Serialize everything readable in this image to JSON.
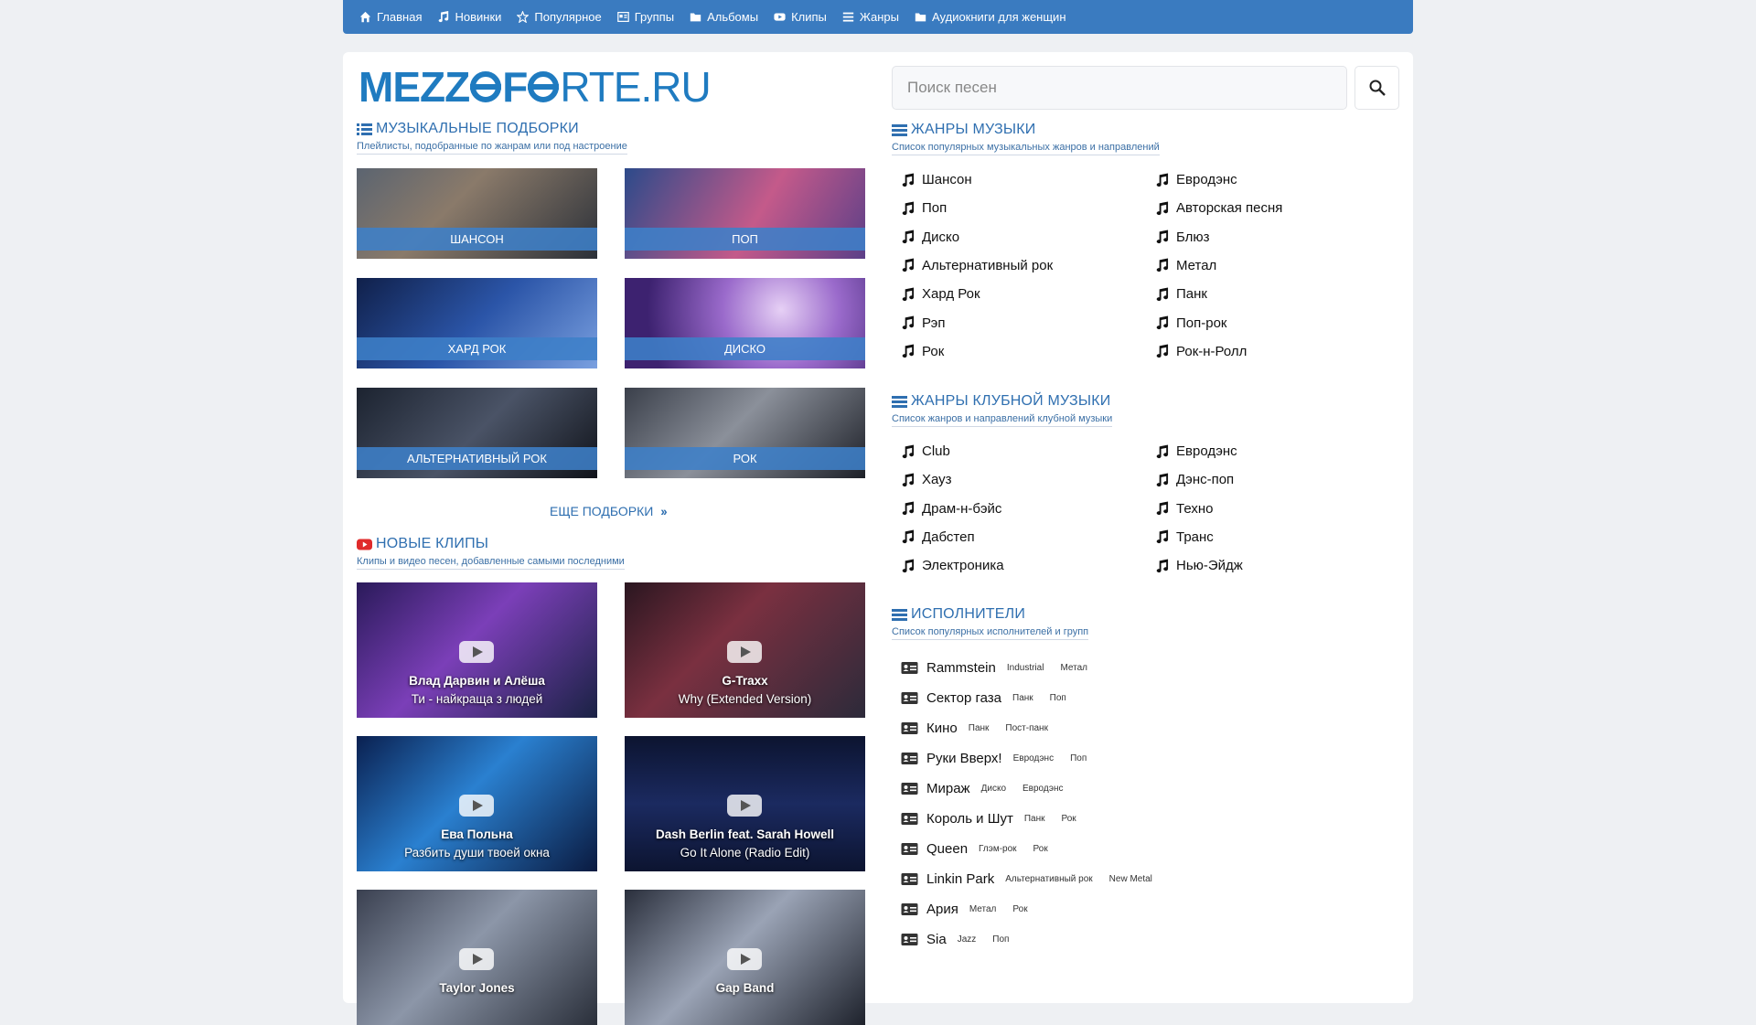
{
  "nav": {
    "items": [
      {
        "label": "Главная",
        "icon": "home-icon"
      },
      {
        "label": "Новинки",
        "icon": "music-note-icon"
      },
      {
        "label": "Популярное",
        "icon": "star-icon"
      },
      {
        "label": "Группы",
        "icon": "id-card-icon"
      },
      {
        "label": "Альбомы",
        "icon": "folder-icon"
      },
      {
        "label": "Клипы",
        "icon": "youtube-icon"
      },
      {
        "label": "Жанры",
        "icon": "menu-icon"
      },
      {
        "label": "Аудиокниги для женщин",
        "icon": "folder-icon"
      }
    ]
  },
  "logo": {
    "part1": "MEZZ",
    "part2": "F",
    "part3": "RTE.RU"
  },
  "search": {
    "placeholder": "Поиск песен"
  },
  "collections": {
    "title": "Музыкальные подборки",
    "subtitle": "Плейлисты, подобранные по жанрам или под настроение",
    "tiles": [
      {
        "label": "Шансон"
      },
      {
        "label": "Поп"
      },
      {
        "label": "Хард Рок"
      },
      {
        "label": "Диско"
      },
      {
        "label": "Альтернативный рок"
      },
      {
        "label": "Рок"
      }
    ],
    "more_label": "ЕЩЕ ПОДБОРКИ"
  },
  "clips": {
    "title": "Новые клипы",
    "subtitle": "Клипы и видео песен, добавленные самыми последними",
    "items": [
      {
        "artist": "Влад Дарвин и Алёша",
        "song": "Ти - найкраща з людей"
      },
      {
        "artist": "G-Traxx",
        "song": "Why (Extended Version)"
      },
      {
        "artist": "Ева Польна",
        "song": "Разбить души твоей окна"
      },
      {
        "artist": "Dash Berlin feat. Sarah Howell",
        "song": "Go It Alone (Radio Edit)"
      },
      {
        "artist": "Taylor Jones",
        "song": ""
      },
      {
        "artist": "Gap Band",
        "song": ""
      }
    ]
  },
  "genres": {
    "title": "Жанры музыки",
    "subtitle": "Список популярных музыкальных жанров и направлений",
    "left": [
      "Шансон",
      "Поп",
      "Диско",
      "Альтернативный рок",
      "Хард Рок",
      "Рэп",
      "Рок"
    ],
    "right": [
      "Евродэнс",
      "Авторская песня",
      "Блюз",
      "Метал",
      "Панк",
      "Поп-рок",
      "Рок-н-Ролл"
    ]
  },
  "club": {
    "title": "Жанры клубной музыки",
    "subtitle": "Список жанров и направлений клубной музыки",
    "left": [
      "Club",
      "Хауз",
      "Драм-н-бэйс",
      "Дабстеп",
      "Электроника"
    ],
    "right": [
      "Евродэнс",
      "Дэнс-поп",
      "Техно",
      "Транс",
      "Нью-Эйдж"
    ]
  },
  "artists": {
    "title": "Исполнители",
    "subtitle": "Список популярных исполнителей и групп",
    "items": [
      {
        "name": "Rammstein",
        "tags": [
          "Industrial",
          "Метал"
        ]
      },
      {
        "name": "Сектор газа",
        "tags": [
          "Панк",
          "Поп"
        ]
      },
      {
        "name": "Кино",
        "tags": [
          "Панк",
          "Пост-панк"
        ]
      },
      {
        "name": "Руки Вверх!",
        "tags": [
          "Евродэнс",
          "Поп"
        ]
      },
      {
        "name": "Мираж",
        "tags": [
          "Диско",
          "Евродэнс"
        ]
      },
      {
        "name": "Король и Шут",
        "tags": [
          "Панк",
          "Рок"
        ]
      },
      {
        "name": "Queen",
        "tags": [
          "Глэм-рок",
          "Рок"
        ]
      },
      {
        "name": "Linkin Park",
        "tags": [
          "Альтернативный рок",
          "New Metal"
        ]
      },
      {
        "name": "Ария",
        "tags": [
          "Метал",
          "Рок"
        ]
      },
      {
        "name": "Sia",
        "tags": [
          "Jazz",
          "Поп"
        ]
      }
    ]
  },
  "colors": {
    "accent": "#3a7bc0",
    "title": "#2f6fb0",
    "background": "#eef0f3"
  }
}
